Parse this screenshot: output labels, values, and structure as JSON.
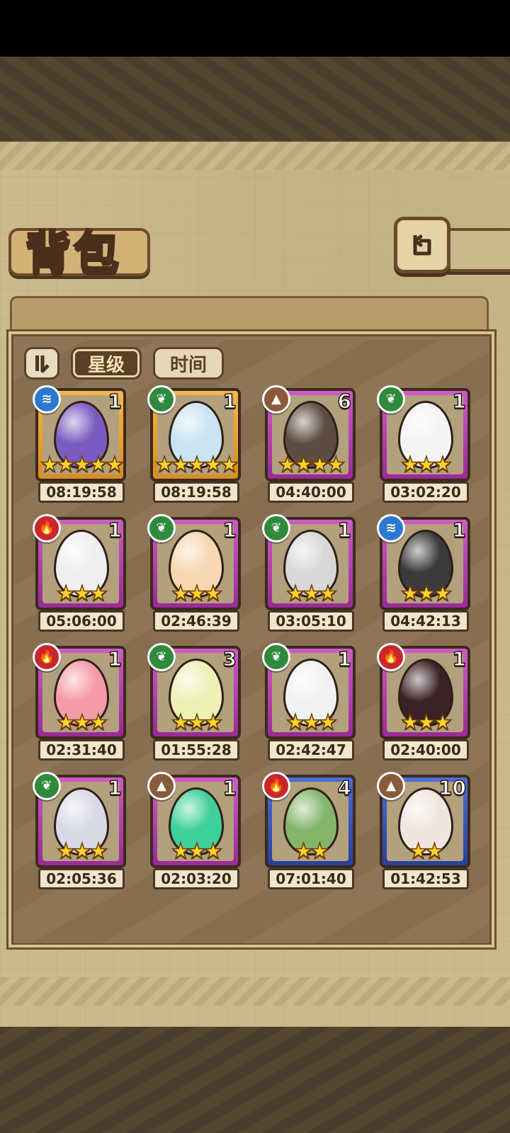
{
  "screen": {
    "title": "背包",
    "sort_tabs": [
      {
        "label": "星级",
        "active": true
      },
      {
        "label": "时间",
        "active": false
      }
    ]
  },
  "items": [
    {
      "element": "water",
      "rarity": "gold",
      "count": "1",
      "stars": 5,
      "timer": "08:19:58",
      "art": "purple-pocket-watch",
      "egg_color": "#7a5bc0"
    },
    {
      "element": "leaf",
      "rarity": "gold",
      "count": "1",
      "stars": 5,
      "timer": "08:19:58",
      "art": "silver-pocket-watch",
      "egg_color": "#c9e3f2"
    },
    {
      "element": "earth",
      "rarity": "purple",
      "count": "6",
      "stars": 4,
      "timer": "04:40:00",
      "art": "brown-creature",
      "egg_color": "#5d4c42"
    },
    {
      "element": "leaf",
      "rarity": "purple",
      "count": "1",
      "stars": 3,
      "timer": "03:02:20",
      "art": "white-egg-gold-ring",
      "egg_color": "#f4f4f4"
    },
    {
      "element": "fire",
      "rarity": "purple",
      "count": "1",
      "stars": 3,
      "timer": "05:06:00",
      "art": "hooded-white-egg",
      "egg_color": "#efefef"
    },
    {
      "element": "leaf",
      "rarity": "purple",
      "count": "1",
      "stars": 3,
      "timer": "02:46:39",
      "art": "pink-egg-feather-nest",
      "egg_color": "#f6d7b2"
    },
    {
      "element": "leaf",
      "rarity": "purple",
      "count": "1",
      "stars": 3,
      "timer": "03:05:10",
      "art": "egg-with-horns",
      "egg_color": "#d8d8d8"
    },
    {
      "element": "water",
      "rarity": "purple",
      "count": "1",
      "stars": 3,
      "timer": "04:42:13",
      "art": "spiked-black-egg",
      "egg_color": "#3a3a3a"
    },
    {
      "element": "fire",
      "rarity": "purple",
      "count": "1",
      "stars": 3,
      "timer": "02:31:40",
      "art": "pink-crowned-egg",
      "egg_color": "#f59aa8"
    },
    {
      "element": "leaf",
      "rarity": "purple",
      "count": "3",
      "stars": 3,
      "timer": "01:55:28",
      "art": "leafy-yellow-egg",
      "egg_color": "#eef0b6"
    },
    {
      "element": "leaf",
      "rarity": "purple",
      "count": "1",
      "stars": 3,
      "timer": "02:42:47",
      "art": "winged-white-egg",
      "egg_color": "#f2f2f2"
    },
    {
      "element": "fire",
      "rarity": "purple",
      "count": "1",
      "stars": 3,
      "timer": "02:40:00",
      "art": "dark-lava-egg",
      "egg_color": "#3a2226"
    },
    {
      "element": "leaf",
      "rarity": "purple",
      "count": "1",
      "stars": 3,
      "timer": "02:05:36",
      "art": "studded-black-white-egg",
      "egg_color": "#d9d9e6"
    },
    {
      "element": "earth",
      "rarity": "purple",
      "count": "1",
      "stars": 3,
      "timer": "02:03:20",
      "art": "green-crystal-orb",
      "egg_color": "#3ed09a"
    },
    {
      "element": "fire",
      "rarity": "blue",
      "count": "4",
      "stars": 2,
      "timer": "07:01:40",
      "art": "green-cactus-egg",
      "egg_color": "#84b56b"
    },
    {
      "element": "earth",
      "rarity": "blue",
      "count": "10",
      "stars": 2,
      "timer": "01:42:53",
      "art": "fluffy-moth-egg",
      "egg_color": "#f1e6df"
    }
  ],
  "element_colors": {
    "water": "#2d79d1",
    "leaf": "#2f8a3c",
    "earth": "#8a5a3a",
    "fire": "#c9262b"
  },
  "element_glyphs": {
    "water": "≋",
    "leaf": "❦",
    "earth": "▲",
    "fire": "🔥"
  }
}
